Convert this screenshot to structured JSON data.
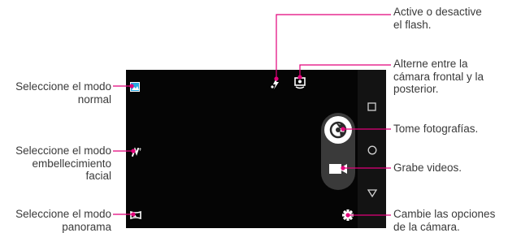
{
  "callouts": {
    "flash": "Active o desactive\nel flash.",
    "switch_camera": "Alterne entre la\ncámara frontal y la\nposterior.",
    "take_photo": "Tome fotografías.",
    "record_video": "Grabe videos.",
    "settings": "Cambie las opciones\nde la cámara.",
    "normal_mode": "Seleccione el modo\nnormal",
    "beauty_mode": "Seleccione el modo\nembellecimiento\nfacial",
    "panorama_mode": "Seleccione el modo\npanorama"
  },
  "icons": {
    "flash": "flash-auto-icon",
    "switch_camera": "switch-camera-icon",
    "shutter": "shutter-icon",
    "record": "video-record-icon",
    "settings": "gear-icon",
    "normal_mode": "image-icon",
    "beauty_mode": "beauty-icon",
    "panorama_mode": "panorama-icon",
    "nav_recent": "square-nav-icon",
    "nav_home": "circle-nav-icon",
    "nav_back": "triangle-nav-icon"
  },
  "colors": {
    "leader_line": "#e2007a",
    "screen_bg": "#050505",
    "accent_blue": "#29a8e0"
  }
}
